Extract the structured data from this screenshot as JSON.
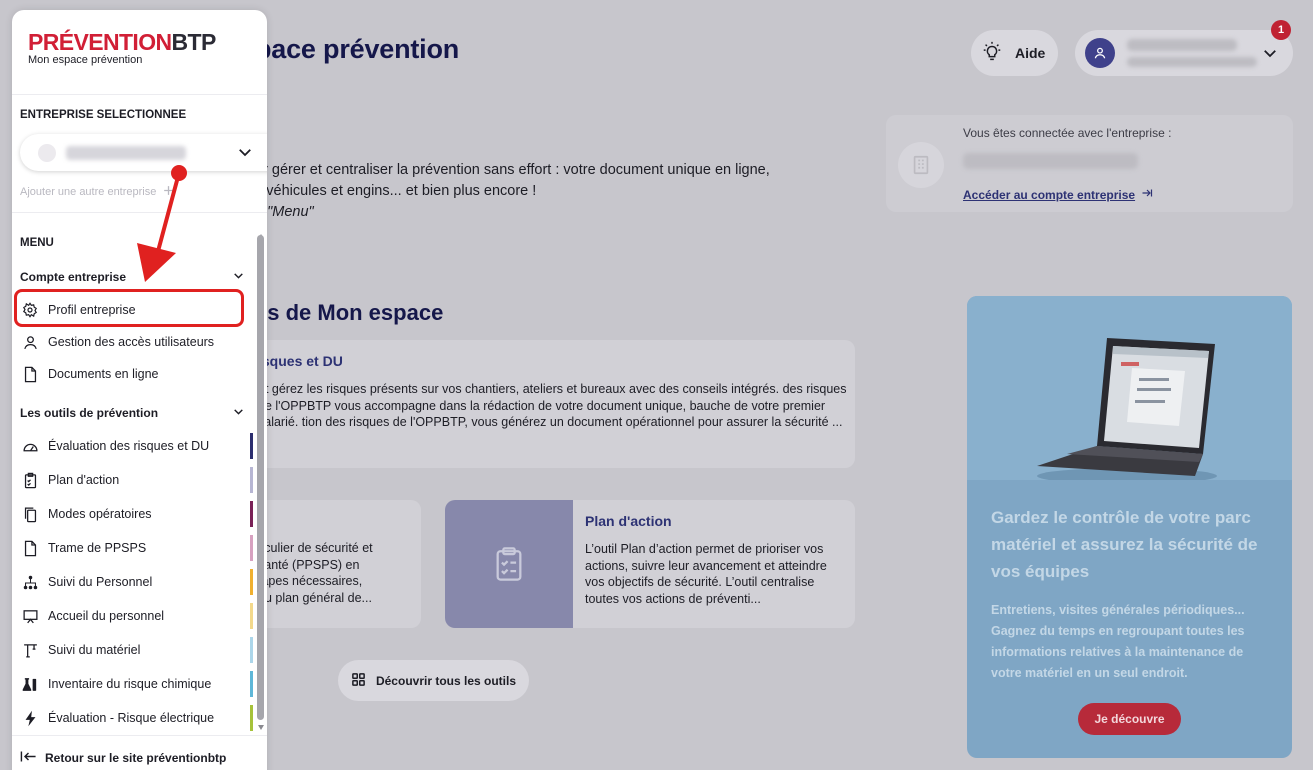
{
  "header": {
    "page_title": "pace prévention",
    "aide_label": "Aide",
    "notification_count": "1"
  },
  "intro": {
    "line1": "ur gérer et centraliser la prévention sans effort : votre document unique en ligne,",
    "line2": "s véhicules et engins... et bien plus encore !",
    "line3": "e \"Menu\""
  },
  "company_card": {
    "label": "Vous êtes connectée avec l'entreprise :",
    "link": "Accéder au compte entreprise"
  },
  "section": {
    "title": "és de Mon espace"
  },
  "cards": {
    "risk": {
      "title": "isques et DU",
      "body": "et gérez les risques présents sur vos chantiers, ateliers et bureaux avec des conseils intégrés. des risques de l'OPPBTP vous accompagne dans la rédaction de votre document unique, bauche de votre premier salarié. tion des risques de l'OPPBTP, vous générez un document opérationnel pour assurer la sécurité ..."
    },
    "ppsps": {
      "line1": "ticulier de sécurité et",
      "line2": "santé (PPSPS) en",
      "line3": "tapes nécessaires,",
      "line4": "du plan général de..."
    },
    "plan": {
      "title": "Plan d'action",
      "body": "L’outil Plan d’action permet de prioriser vos actions, suivre leur avancement et atteindre vos objectifs de sécurité. L’outil centralise toutes vos actions de préventi..."
    }
  },
  "discover_button": "Découvrir tous les outils",
  "promo": {
    "title": "Gardez le contrôle de votre parc matériel et assurez la sécurité de vos équipes",
    "body": "Entretiens, visites générales périodiques... Gagnez du temps en regroupant toutes les informations relatives à la maintenance de votre matériel en un seul endroit.",
    "cta": "Je découvre"
  },
  "sidebar": {
    "logo_red": "PRÉVENTION",
    "logo_dark": "BTP",
    "logo_sub": "Mon espace prévention",
    "company_label": "ENTREPRISE SELECTIONNEE",
    "add_company": "Ajouter une autre entreprise",
    "menu_label": "MENU",
    "group1": "Compte entreprise",
    "group1_items": [
      {
        "label": "Profil entreprise"
      },
      {
        "label": "Gestion des accès utilisateurs"
      },
      {
        "label": "Documents en ligne"
      }
    ],
    "group2": "Les outils de prévention",
    "group2_items": [
      {
        "label": "Évaluation des risques et DU",
        "color": "#2b2d6e"
      },
      {
        "label": "Plan d'action",
        "color": "#b7b6d3"
      },
      {
        "label": "Modes opératoires",
        "color": "#7a2157"
      },
      {
        "label": "Trame de PPSPS",
        "color": "#d7a1c0"
      },
      {
        "label": "Suivi du Personnel",
        "color": "#f0b030"
      },
      {
        "label": "Accueil du personnel",
        "color": "#f3d98c"
      },
      {
        "label": "Suivi du matériel",
        "color": "#acd6ea"
      },
      {
        "label": "Inventaire du risque chimique",
        "color": "#5fb7d8"
      },
      {
        "label": "Évaluation - Risque électrique",
        "color": "#a6c23a"
      }
    ],
    "back_link": "Retour sur le site préventionbtp"
  },
  "colors": {
    "accent_red": "#e02120",
    "brand_navy": "#15174a"
  }
}
